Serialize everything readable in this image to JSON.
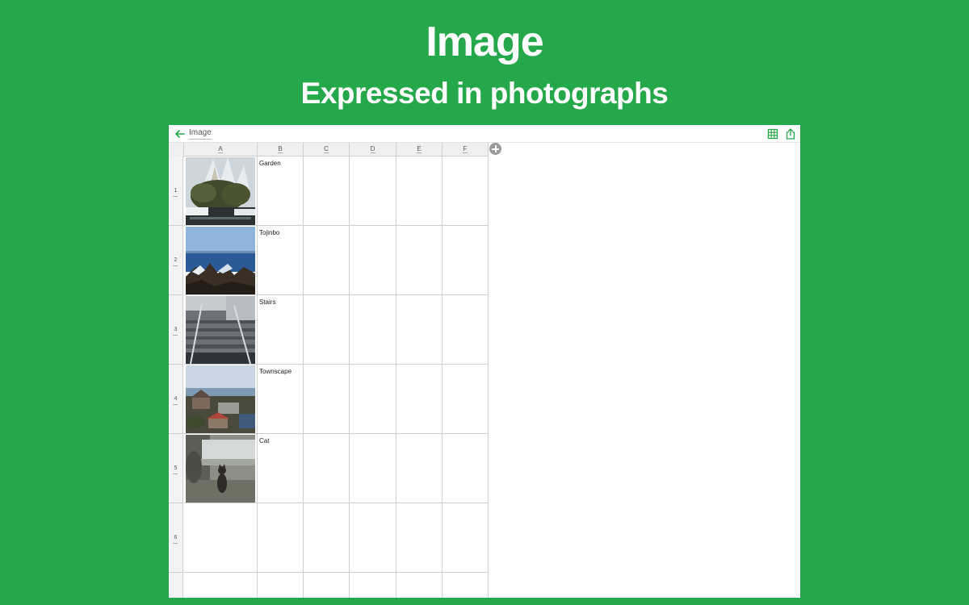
{
  "hero": {
    "title": "Image",
    "subtitle": "Expressed in photographs"
  },
  "toolbar": {
    "sheet_name": "Image",
    "back_icon": "back-arrow-icon",
    "grid_icon": "grid-icon",
    "share_icon": "share-icon"
  },
  "columns": [
    "A",
    "B",
    "C",
    "D",
    "E",
    "F"
  ],
  "rows": [
    {
      "number": "1",
      "image": "Garden photo",
      "label": "Garden"
    },
    {
      "number": "2",
      "image": "Tojinbo photo",
      "label": "Tojinbo"
    },
    {
      "number": "3",
      "image": "Stairs photo",
      "label": "Stairs"
    },
    {
      "number": "4",
      "image": "Townscape photo",
      "label": "Townscape"
    },
    {
      "number": "5",
      "image": "Cat photo",
      "label": "Cat"
    },
    {
      "number": "6",
      "image": "",
      "label": ""
    }
  ],
  "colors": {
    "background": "#25a84a",
    "accent": "#25a84a"
  }
}
